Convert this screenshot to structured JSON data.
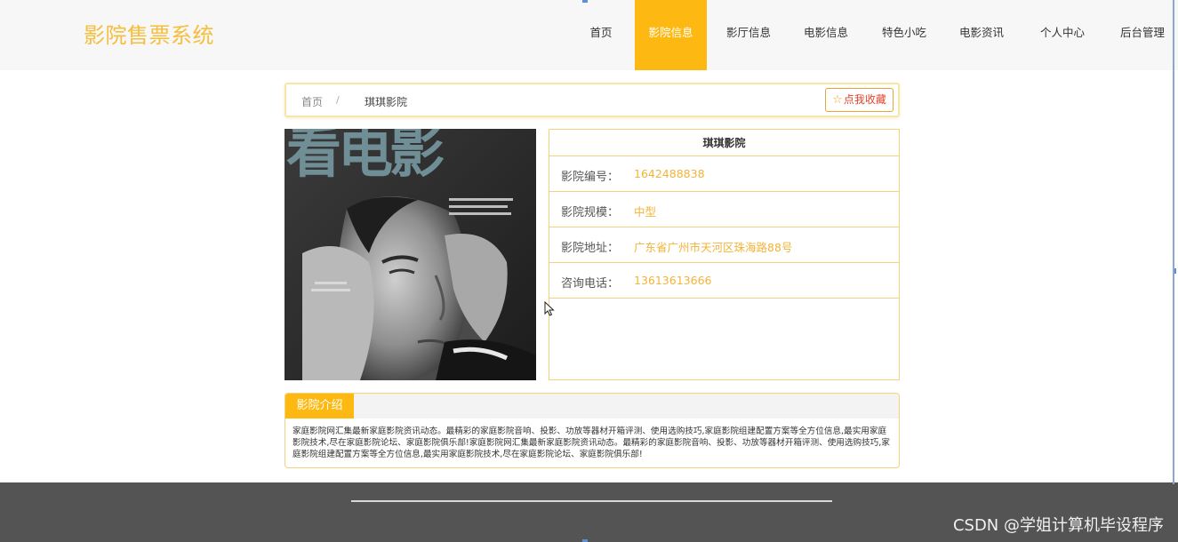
{
  "app": {
    "title": "影院售票系统"
  },
  "nav": {
    "items": [
      {
        "label": "首页"
      },
      {
        "label": "影院信息"
      },
      {
        "label": "影厅信息"
      },
      {
        "label": "电影信息"
      },
      {
        "label": "特色小吃"
      },
      {
        "label": "电影资讯"
      },
      {
        "label": "个人中心"
      },
      {
        "label": "后台管理"
      }
    ],
    "active_label": "影院信息"
  },
  "breadcrumb": {
    "home": "首页",
    "separator": "/",
    "current": "琪琪影院"
  },
  "favorite": {
    "icon": "star-icon",
    "label": "点我收藏"
  },
  "detail": {
    "name": "琪琪影院",
    "rows": [
      {
        "label": "影院编号：",
        "value": "1642488838"
      },
      {
        "label": "影院规模：",
        "value": "中型"
      },
      {
        "label": "影院地址：",
        "value": "广东省广州市天河区珠海路88号"
      },
      {
        "label": "咨询电话：",
        "value": "13613613666"
      }
    ]
  },
  "poster": {
    "headline": "看电影"
  },
  "intro": {
    "tab_label": "影院介绍",
    "text": "家庭影院网汇集最新家庭影院资讯动态。最精彩的家庭影院音响、投影、功放等器材开箱评测、使用选购技巧,家庭影院组建配置方案等全方位信息,最实用家庭影院技术,尽在家庭影院论坛、家庭影院俱乐部!家庭影院网汇集最新家庭影院资讯动态。最精彩的家庭影院音响、投影、功放等器材开箱评测、使用选购技巧,家庭影院组建配置方案等全方位信息,最实用家庭影院技术,尽在家庭影院论坛、家庭影院俱乐部!"
  },
  "watermark": "CSDN @学姐计算机毕设程序",
  "colors": {
    "accent": "#fdb911",
    "logo": "#f6be3b",
    "value_text": "#f2b43a",
    "footer": "#545454"
  }
}
